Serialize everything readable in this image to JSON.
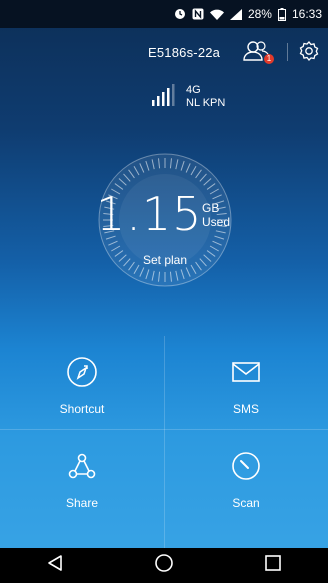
{
  "status_bar": {
    "battery_percent": "28%",
    "time": "16:33",
    "icons": [
      "nfc-icon",
      "wifi-icon",
      "cell-signal-icon",
      "battery-icon",
      "alarm-icon"
    ]
  },
  "header": {
    "device_name": "E5186s-22a",
    "notification_count": "1"
  },
  "network": {
    "type": "4G",
    "operator": "NL KPN",
    "signal_level": 4
  },
  "usage": {
    "value": "1.15",
    "unit": "GB",
    "label": "Used",
    "set_plan_label": "Set plan"
  },
  "tiles": [
    {
      "label": "Shortcut",
      "icon": "shortcut-icon"
    },
    {
      "label": "SMS",
      "icon": "envelope-icon"
    },
    {
      "label": "Share",
      "icon": "share-icon"
    },
    {
      "label": "Scan",
      "icon": "scan-icon"
    }
  ],
  "nav": [
    "back-icon",
    "home-icon",
    "recents-icon"
  ],
  "colors": {
    "bg_top": "#0c2e56",
    "bg_bottom": "#3aa5e6",
    "badge": "#e23a2a"
  }
}
